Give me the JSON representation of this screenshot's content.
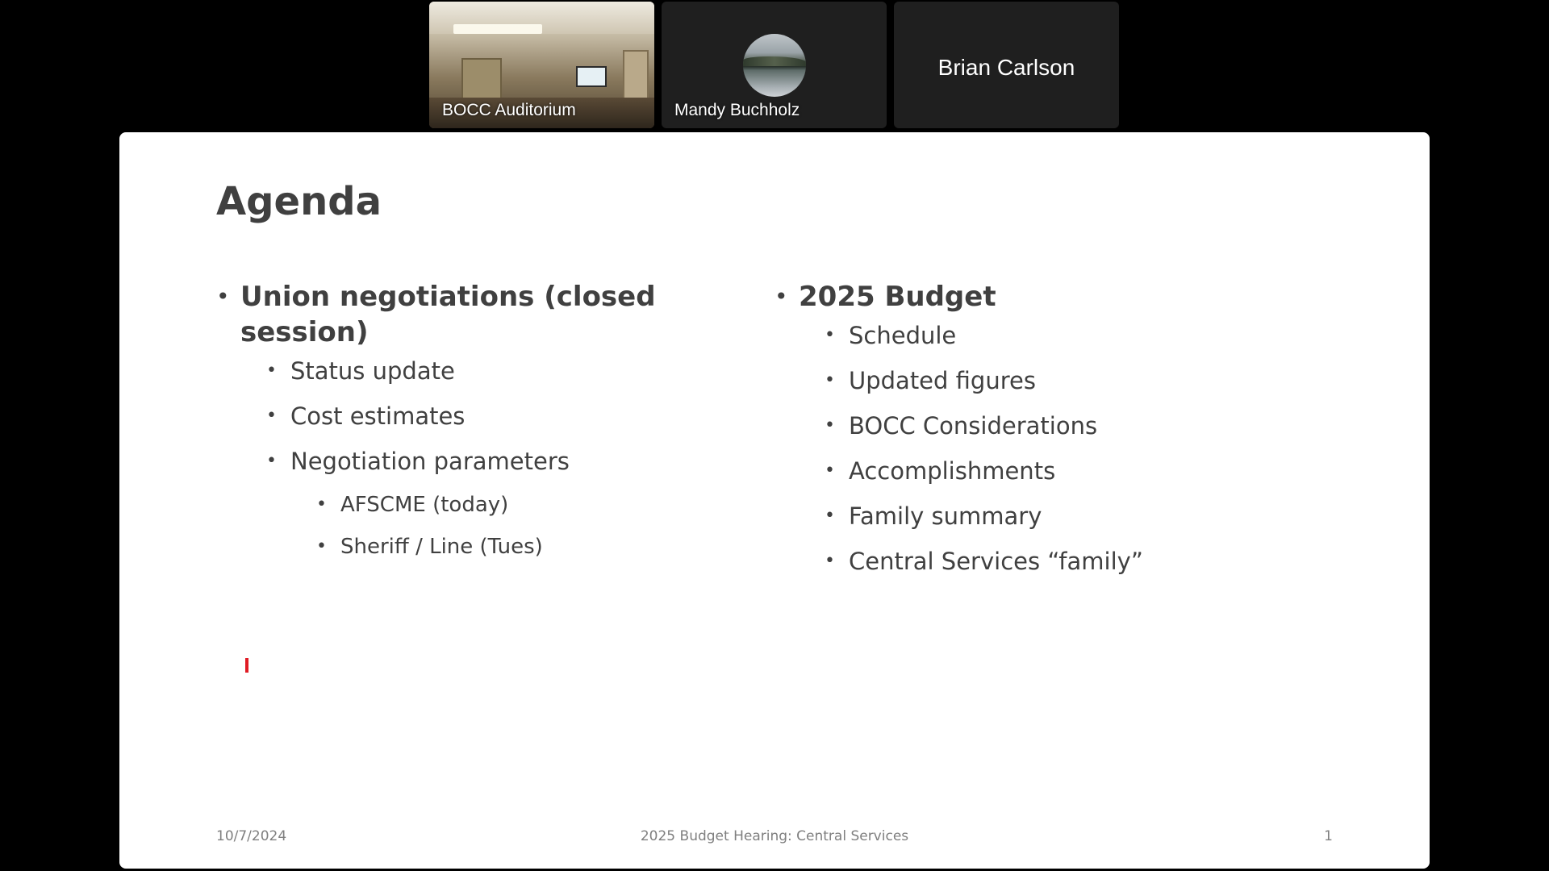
{
  "participants": [
    {
      "name": "BOCC Auditorium",
      "kind": "video"
    },
    {
      "name": "Mandy Buchholz",
      "kind": "avatar"
    },
    {
      "name": "Brian Carlson",
      "kind": "name-only"
    }
  ],
  "slide": {
    "title": "Agenda",
    "left_column": {
      "heading": "Union negotiations (closed session)",
      "items": [
        "Status update",
        "Cost estimates",
        "Negotiation parameters"
      ],
      "sub_items": [
        "AFSCME (today)",
        "Sheriff / Line (Tues)"
      ]
    },
    "right_column": {
      "heading": "2025 Budget",
      "items": [
        "Schedule",
        "Updated figures",
        "BOCC Considerations",
        "Accomplishments",
        "Family summary",
        "Central Services “family”"
      ]
    },
    "footer": {
      "date": "10/7/2024",
      "title": "2025 Budget Hearing: Central Services",
      "page": "1"
    }
  },
  "icons": {
    "bullet": "•"
  },
  "colors": {
    "slide_text": "#404040",
    "footer_text": "#7f7f7f",
    "pointer": "#e01b24",
    "tile_bg": "#1f1f1f"
  }
}
